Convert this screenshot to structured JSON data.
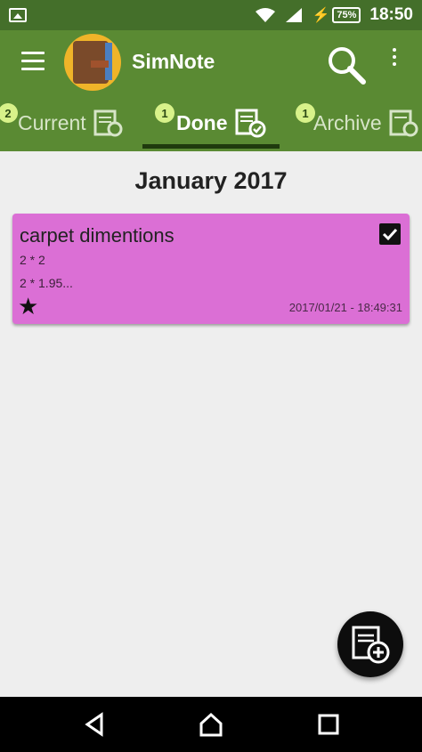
{
  "status_bar": {
    "time": "18:50",
    "battery": "75%"
  },
  "app_bar": {
    "title": "SimNote"
  },
  "tabs": [
    {
      "label": "Current",
      "badge": "2"
    },
    {
      "label": "Done",
      "badge": "1"
    },
    {
      "label": "Archive",
      "badge": "1"
    }
  ],
  "month_header": "January 2017",
  "note": {
    "title": "carpet dimentions",
    "line1": "2 * 2",
    "line2": "2 * 1.95...",
    "date": "2017/01/21 - 18:49:31",
    "checked": true,
    "starred": true,
    "color": "#db6fd5"
  },
  "colors": {
    "app_bar": "#5a8a33",
    "status_bar": "#446f2a",
    "background": "#eeeeee"
  },
  "icons": {
    "menu": "hamburger-icon",
    "search": "search-icon",
    "more": "more-vert-icon",
    "tab_current": "note-settings-icon",
    "tab_done": "note-check-icon",
    "tab_archive": "note-archive-icon",
    "fab": "add-note-icon"
  }
}
